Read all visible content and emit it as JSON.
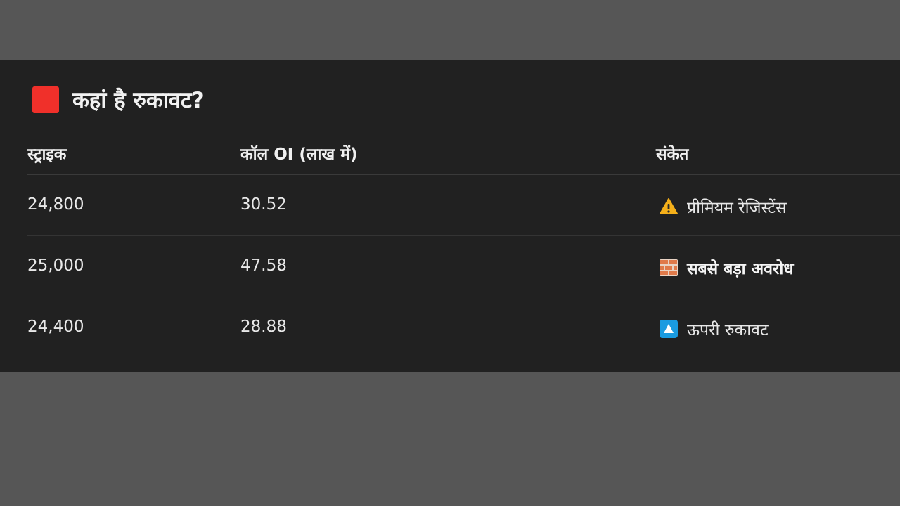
{
  "title": {
    "text": "कहां है रुकावट?",
    "marker_color": "#f0302a"
  },
  "table": {
    "headers": [
      "स्ट्राइक",
      "कॉल OI (लाख में)",
      "संकेत"
    ],
    "rows": [
      {
        "strike": "24,800",
        "call_oi": "30.52",
        "signal": "प्रीमियम रेजिस्टेंस",
        "signal_icon": "warning-icon",
        "bold": false
      },
      {
        "strike": "25,000",
        "call_oi": "47.58",
        "signal": "सबसे बड़ा अवरोध",
        "signal_icon": "brick-wall-icon",
        "bold": true
      },
      {
        "strike": "24,400",
        "call_oi": "28.88",
        "signal": "ऊपरी रुकावट",
        "signal_icon": "up-button-icon",
        "bold": false
      }
    ]
  },
  "colors": {
    "page_background": "#565656",
    "panel_background": "#212121",
    "warning": "#f5b01a",
    "brick": "#e07a4a",
    "up_button": "#1a9be0"
  }
}
